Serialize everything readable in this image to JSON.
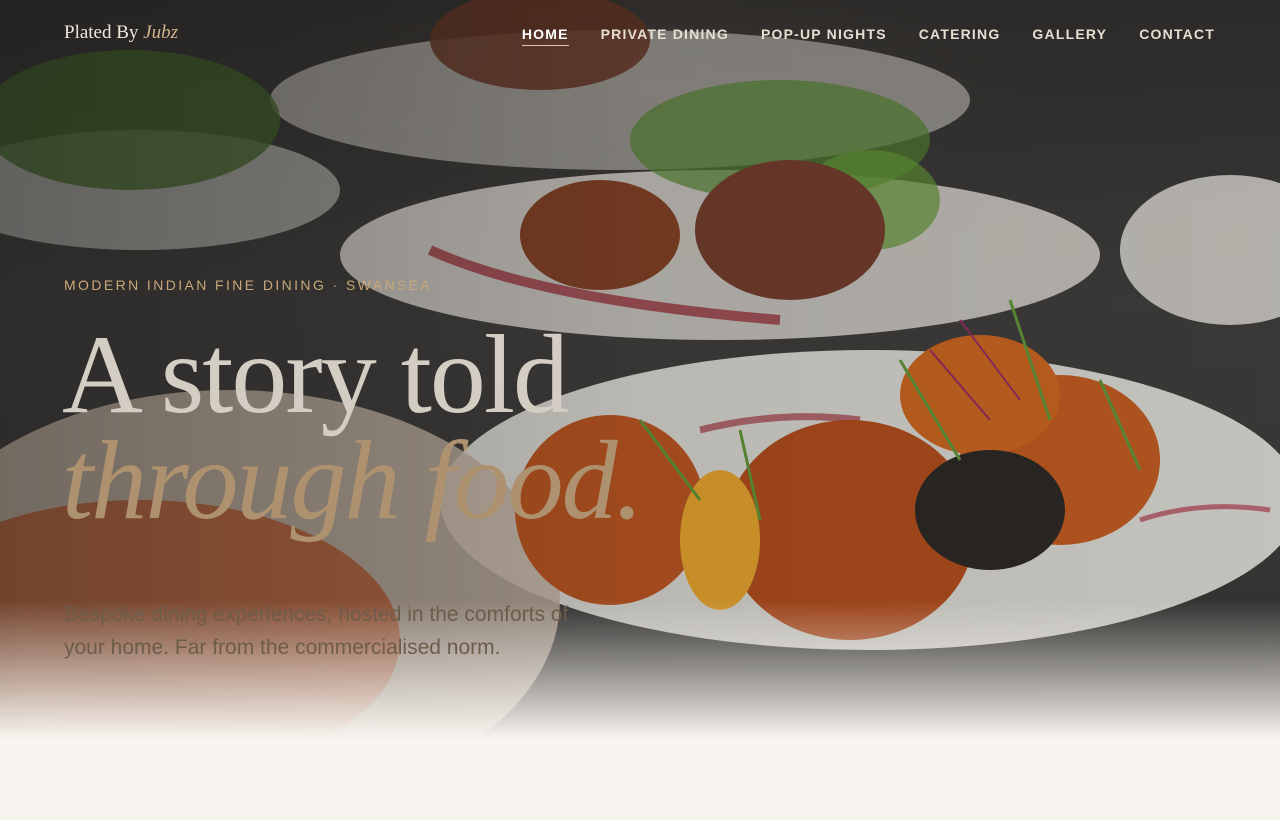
{
  "nav": {
    "brand": {
      "name": "Plated By",
      "accent": "Jubz"
    },
    "items": [
      {
        "label": "HOME",
        "active": true
      },
      {
        "label": "PRIVATE DINING"
      },
      {
        "label": "POP-UP NIGHTS"
      },
      {
        "label": "CATERING"
      },
      {
        "label": "GALLERY"
      },
      {
        "label": "CONTACT"
      }
    ]
  },
  "hero": {
    "eyebrow": "MODERN INDIAN FINE DINING · SWANSEA",
    "headline_line1": "A story told",
    "headline_line2": "through food.",
    "subtitle": "Bespoke dining experiences, hosted in the comforts of your home. Far from the commercialised norm."
  },
  "colors": {
    "accent": "#c9a77a",
    "background": "#f8f5f0",
    "nav_text": "#e7ded2"
  }
}
